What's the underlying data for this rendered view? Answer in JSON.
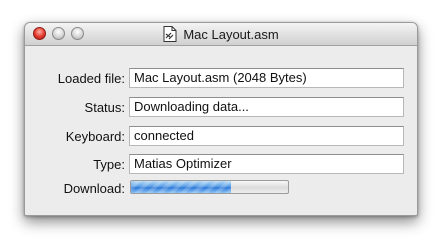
{
  "window": {
    "title": "Mac Layout.asm"
  },
  "fields": [
    {
      "label": "Loaded file:",
      "value": "Mac Layout.asm (2048 Bytes)"
    },
    {
      "label": "Status:",
      "value": "Downloading data..."
    },
    {
      "label": "Keyboard:",
      "value": "connected"
    },
    {
      "label": "Type:",
      "value": "Matias Optimizer"
    }
  ],
  "download": {
    "label": "Download:",
    "progress_percent": 64,
    "bar_color": "#4a90e2"
  },
  "icons": {
    "close": "close-button-red",
    "minimize": "minimize-button",
    "zoom": "zoom-button",
    "document": "document-icon"
  }
}
